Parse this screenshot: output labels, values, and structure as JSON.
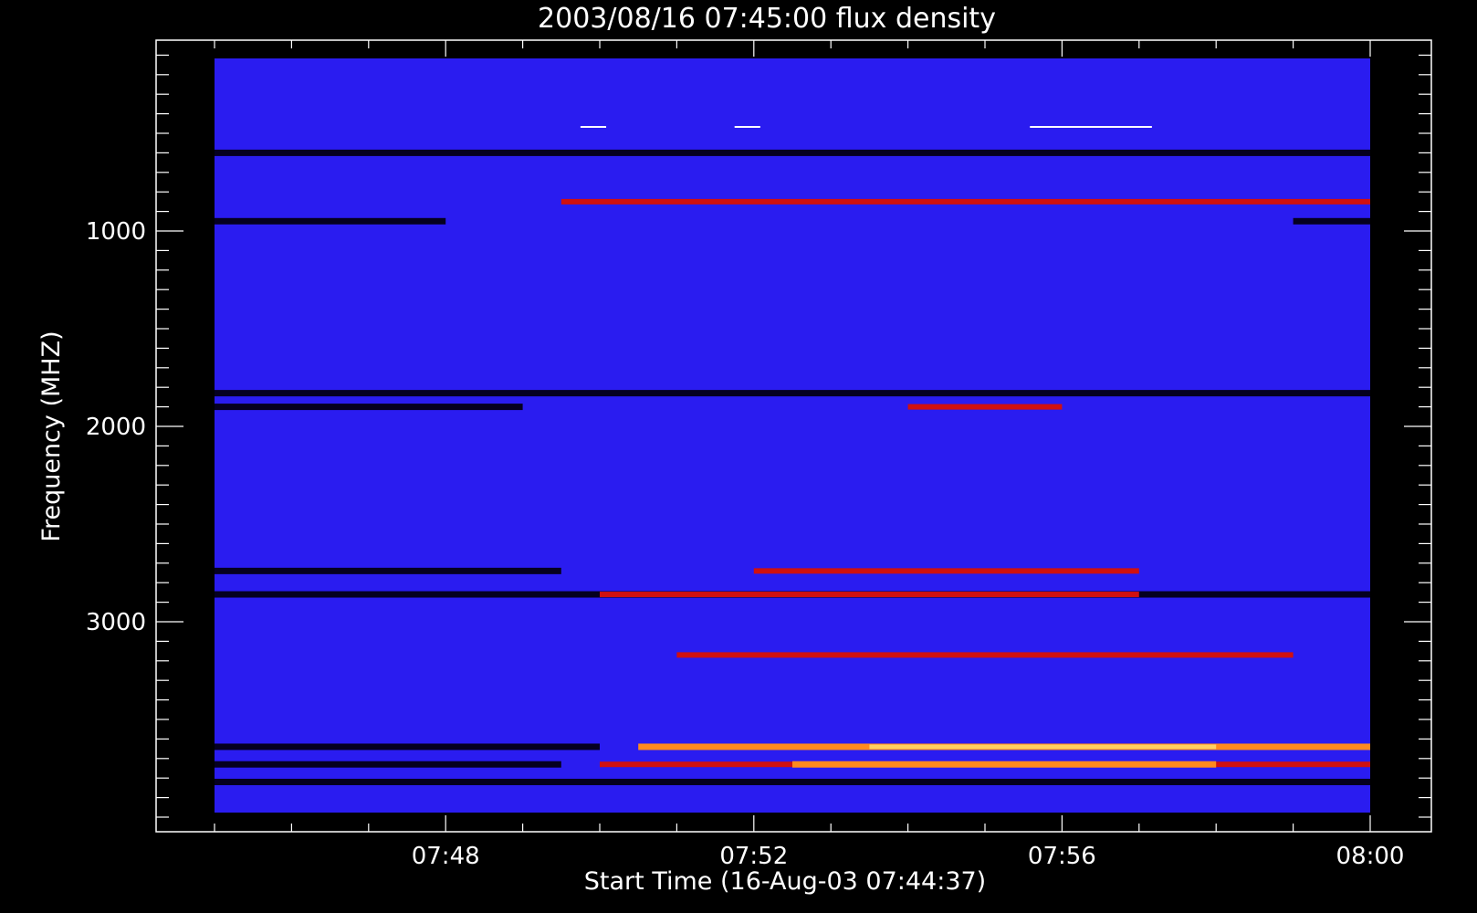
{
  "chart_data": {
    "type": "heatmap",
    "title": "2003/08/16 07:45:00 flux density",
    "xlabel": "Start Time (16-Aug-03 07:44:37)",
    "ylabel": "Frequency (MHZ)",
    "x_ticks": [
      "07:48",
      "07:52",
      "07:56",
      "08:00"
    ],
    "y_ticks": [
      "1000",
      "2000",
      "3000"
    ],
    "x_range": [
      "07:44:37",
      "08:00:00"
    ],
    "y_range": [
      1000,
      4000
    ],
    "y_axis_inverted": true,
    "colors": {
      "background": "#000000",
      "base": "#2a1cf0",
      "dark": "#050020",
      "red": "#d01010",
      "orange": "#ff8a1e",
      "yellow": "#ffd060",
      "marker": "#ffffff"
    },
    "bands": [
      {
        "freq": 600,
        "intensity": "dark",
        "from": "07:44:37",
        "to": "08:00:00"
      },
      {
        "freq": 850,
        "intensity": "red",
        "from": "07:49:30",
        "to": "08:00:00"
      },
      {
        "freq": 950,
        "intensity": "dark",
        "from": "07:44:37",
        "to": "07:48:00"
      },
      {
        "freq": 950,
        "intensity": "dark",
        "from": "07:59:00",
        "to": "08:00:00"
      },
      {
        "freq": 1830,
        "intensity": "dark",
        "from": "07:44:37",
        "to": "08:00:00"
      },
      {
        "freq": 1900,
        "intensity": "dark",
        "from": "07:44:37",
        "to": "07:49:00"
      },
      {
        "freq": 1900,
        "intensity": "red",
        "from": "07:54:00",
        "to": "07:56:00"
      },
      {
        "freq": 2740,
        "intensity": "dark",
        "from": "07:44:37",
        "to": "07:49:30"
      },
      {
        "freq": 2740,
        "intensity": "red",
        "from": "07:52:00",
        "to": "07:57:00"
      },
      {
        "freq": 2860,
        "intensity": "dark",
        "from": "07:44:37",
        "to": "08:00:00"
      },
      {
        "freq": 2860,
        "intensity": "red",
        "from": "07:50:00",
        "to": "07:57:00"
      },
      {
        "freq": 3170,
        "intensity": "red",
        "from": "07:51:00",
        "to": "07:59:00"
      },
      {
        "freq": 3640,
        "intensity": "dark",
        "from": "07:44:37",
        "to": "07:50:00"
      },
      {
        "freq": 3640,
        "intensity": "orange",
        "from": "07:50:30",
        "to": "08:00:00"
      },
      {
        "freq": 3640,
        "intensity": "yellow",
        "from": "07:53:30",
        "to": "07:58:00"
      },
      {
        "freq": 3730,
        "intensity": "dark",
        "from": "07:44:37",
        "to": "07:49:30"
      },
      {
        "freq": 3730,
        "intensity": "red",
        "from": "07:50:00",
        "to": "08:00:00"
      },
      {
        "freq": 3730,
        "intensity": "orange",
        "from": "07:52:30",
        "to": "07:58:00"
      },
      {
        "freq": 3820,
        "intensity": "dark",
        "from": "07:44:37",
        "to": "08:00:00"
      }
    ],
    "markers": [
      {
        "freq": 350,
        "from": "07:49:45",
        "to": "07:50:05"
      },
      {
        "freq": 350,
        "from": "07:51:45",
        "to": "07:52:05"
      },
      {
        "freq": 350,
        "from": "07:55:35",
        "to": "07:57:10"
      }
    ]
  }
}
